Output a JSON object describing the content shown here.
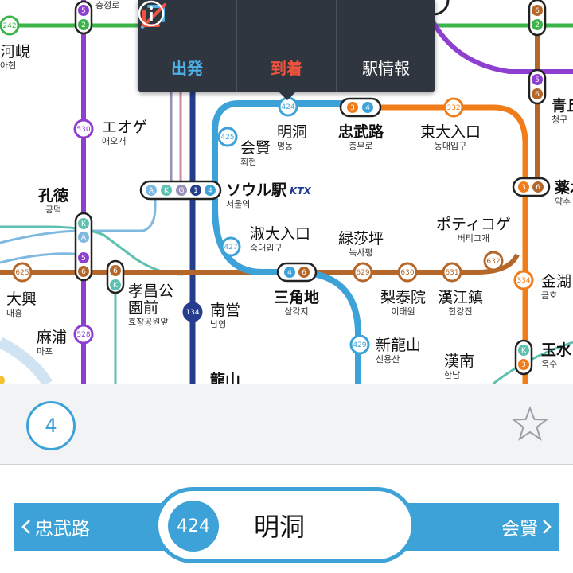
{
  "popup": {
    "departure_label": "出発",
    "arrival_label": "到着",
    "info_label": "駅情報",
    "departure_color": "#4fb0e8",
    "arrival_color": "#f0523c",
    "info_color": "#ffffff"
  },
  "map": {
    "stations": [
      {
        "jp": "河峴",
        "ko": "아현"
      },
      {
        "jp": "エオゲ",
        "ko": "애오개"
      },
      {
        "jp": "孔徳",
        "ko": "공덕"
      },
      {
        "jp": "ソウル駅",
        "ko": "서울역",
        "tag": "KTX"
      },
      {
        "jp": "会賢",
        "ko": "회현"
      },
      {
        "jp": "明洞",
        "ko": "명동"
      },
      {
        "jp": "忠武路",
        "ko": "충무로"
      },
      {
        "jp": "東大入口",
        "ko": "동대입구"
      },
      {
        "jp": "青丘",
        "ko": "청구"
      },
      {
        "jp": "薬水",
        "ko": "약수"
      },
      {
        "jp": "淑大入口",
        "ko": "숙대입구"
      },
      {
        "jp": "緑莎坪",
        "ko": "녹사평"
      },
      {
        "jp": "ポティコゲ",
        "ko": "버티고개"
      },
      {
        "jp": "大興",
        "ko": "대흥"
      },
      {
        "jp": "孝昌公園前",
        "ko": "효창공원앞"
      },
      {
        "jp": "南営",
        "ko": "남영"
      },
      {
        "jp": "三角地",
        "ko": "삼각지"
      },
      {
        "jp": "梨泰院",
        "ko": "이태원"
      },
      {
        "jp": "漢江鎮",
        "ko": "한강진"
      },
      {
        "jp": "金湖",
        "ko": "금호"
      },
      {
        "jp": "麻浦",
        "ko": "마포"
      },
      {
        "jp": "新龍山",
        "ko": "신용산"
      },
      {
        "jp": "漢南",
        "ko": "한남"
      },
      {
        "jp": "玉水",
        "ko": "옥수"
      },
      {
        "jp": "龍山",
        "ko": ""
      },
      {
        "ko": "충정로"
      }
    ],
    "badges": [
      "242",
      "5",
      "2",
      "530",
      "425",
      "424",
      "3",
      "4",
      "332",
      "6",
      "5",
      "6",
      "A",
      "K",
      "G",
      "1",
      "4",
      "3",
      "6",
      "K",
      "A",
      "5",
      "6",
      "427",
      "4",
      "6",
      "629",
      "630",
      "631",
      "632",
      "334",
      "625",
      "6",
      "K",
      "134",
      "528",
      "429",
      "K",
      "3"
    ],
    "colors": {
      "line1": "#263c8c",
      "line2": "#3cb44a",
      "line3": "#f07c1a",
      "line4": "#3da2d8",
      "line5": "#8e3fd0",
      "line6": "#b5672a",
      "airport": "#7fb9e0",
      "gyeongui": "#5ec0b0"
    }
  },
  "info": {
    "line_number": "4",
    "line_color": "#3da2d8",
    "favorite_icon": "star-outline-icon"
  },
  "nav": {
    "prev_label": "忠武路",
    "next_label": "会賢",
    "station_number": "424",
    "station_name": "明洞",
    "prev_icon": "chevron-left-icon",
    "next_icon": "chevron-right-icon"
  }
}
